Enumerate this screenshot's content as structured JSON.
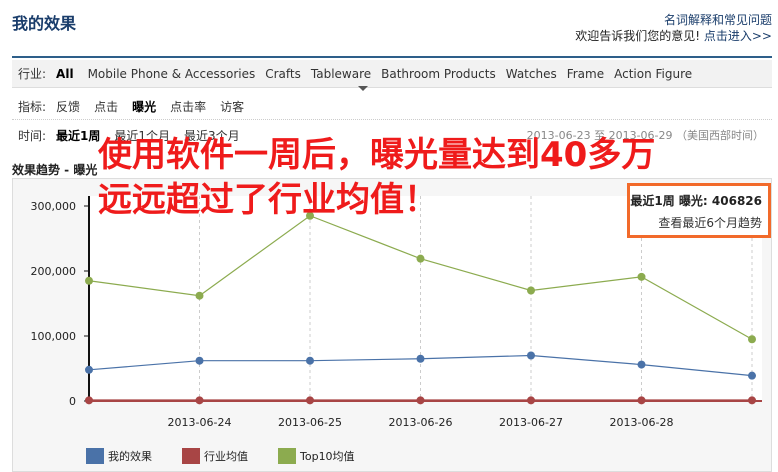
{
  "header": {
    "title": "我的效果",
    "help_link": "名词解释和常见问题",
    "feedback_text": "欢迎告诉我们您的意见!",
    "feedback_link": "点击进入>>"
  },
  "filters": {
    "industry_label": "行业:",
    "industries": [
      "All",
      "Mobile Phone & Accessories",
      "Crafts",
      "Tableware",
      "Bathroom Products",
      "Watches",
      "Frame",
      "Action Figure"
    ],
    "metric_label": "指标:",
    "metrics": [
      "反馈",
      "点击",
      "曝光",
      "点击率",
      "访客"
    ],
    "active_metric": "曝光",
    "time_label": "时间:",
    "periods": [
      "最近1周",
      "最近1个月",
      "最近3个月"
    ],
    "active_period": "最近1周",
    "date_range": "2013-06-23 至 2013-06-29 （美国西部时间）"
  },
  "trend_title": "效果趋势 - 曝光",
  "summary": {
    "label": "最近1周 曝光: 406826",
    "link": "查看最近6个月趋势"
  },
  "overlay": {
    "line1": "使用软件一周后，曝光量达到40多万",
    "line2": "远远超过了行业均值！"
  },
  "colors": {
    "mine": "#4a72a8",
    "industry": "#a84545",
    "top10": "#8cab4f"
  },
  "chart_data": {
    "type": "line",
    "x": [
      "2013-06-23",
      "2013-06-24",
      "2013-06-25",
      "2013-06-26",
      "2013-06-27",
      "2013-06-28",
      "2013-06-29"
    ],
    "x_tick_labels": [
      "2013-06-24",
      "2013-06-25",
      "2013-06-26",
      "2013-06-27",
      "2013-06-28"
    ],
    "y_ticks": [
      "300,000",
      "200,000",
      "100,000",
      "0"
    ],
    "ylim": [
      0,
      300000
    ],
    "series": [
      {
        "name": "我的效果",
        "color": "#4a72a8",
        "values": [
          48000,
          62000,
          62000,
          65000,
          70000,
          56000,
          39000
        ]
      },
      {
        "name": "行业均值",
        "color": "#a84545",
        "values": [
          1000,
          1000,
          1000,
          1000,
          1000,
          1000,
          1000
        ]
      },
      {
        "name": "Top10均值",
        "color": "#8cab4f",
        "values": [
          185000,
          162000,
          285000,
          219000,
          170000,
          191000,
          95000
        ]
      }
    ],
    "legend": "bottom",
    "grid": "vertical-dashed"
  }
}
